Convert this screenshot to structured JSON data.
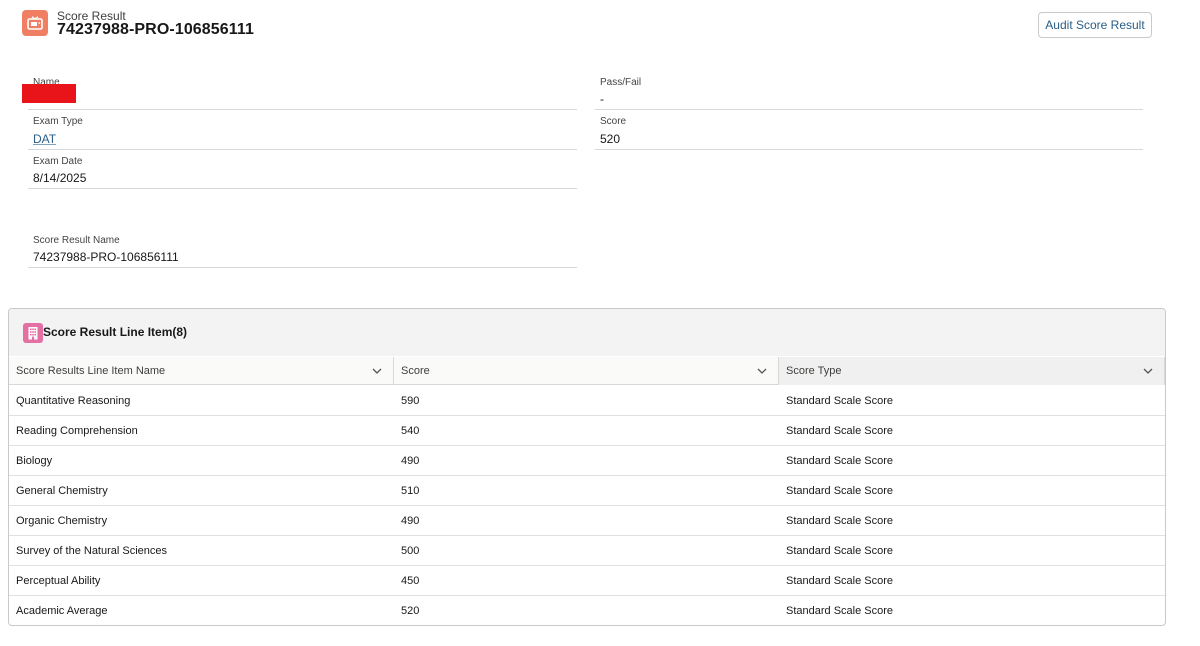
{
  "header": {
    "kicker": "Score Result",
    "title": "74237988-PRO-106856111",
    "audit_button": "Audit Score Result",
    "icon": "tv-icon",
    "icon_color": "#ef7e63"
  },
  "fields": {
    "name": {
      "label": "Name",
      "value": ""
    },
    "pass_fail": {
      "label": "Pass/Fail",
      "value": "-"
    },
    "exam_type": {
      "label": "Exam Type",
      "value": "DAT"
    },
    "score": {
      "label": "Score",
      "value": "520"
    },
    "exam_date": {
      "label": "Exam Date",
      "value": "8/14/2025"
    },
    "score_result_name": {
      "label": "Score Result Name",
      "value": "74237988-PRO-106856111"
    }
  },
  "related_list": {
    "title": "Score Result Line Item(8)",
    "icon": "building-icon",
    "icon_color": "#e46fa3",
    "columns": [
      "Score Results Line Item Name",
      "Score",
      "Score Type"
    ],
    "rows": [
      [
        "Quantitative Reasoning",
        "590",
        "Standard Scale Score"
      ],
      [
        "Reading Comprehension",
        "540",
        "Standard Scale Score"
      ],
      [
        "Biology",
        "490",
        "Standard Scale Score"
      ],
      [
        "General Chemistry",
        "510",
        "Standard Scale Score"
      ],
      [
        "Organic Chemistry",
        "490",
        "Standard Scale Score"
      ],
      [
        "Survey of the Natural Sciences",
        "500",
        "Standard Scale Score"
      ],
      [
        "Perceptual Ability",
        "450",
        "Standard Scale Score"
      ],
      [
        "Academic Average",
        "520",
        "Standard Scale Score"
      ]
    ]
  },
  "colors": {
    "link": "#2a5e87",
    "redaction": "#e8141a"
  }
}
